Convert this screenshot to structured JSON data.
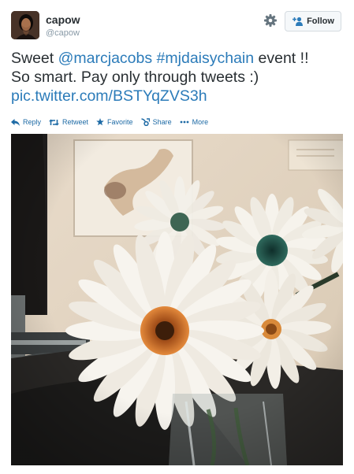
{
  "user": {
    "display_name": "capow",
    "screen_name": "@capow"
  },
  "follow_button": {
    "label": "Follow"
  },
  "tweet": {
    "text_before": "Sweet ",
    "mention": "@marcjacobs",
    "space": " ",
    "hashtag": "#mjdaisychain",
    "text_after": " event !!",
    "line2": "So smart. Pay only through tweets :)",
    "link": "pic.twitter.com/BSTYqZVS3h"
  },
  "actions": {
    "reply": "Reply",
    "retweet": "Retweet",
    "favorite": "Favorite",
    "share": "Share",
    "more": "More"
  },
  "icons": {
    "settings": "gear-icon",
    "follow": "add-user-icon",
    "reply": "reply-icon",
    "retweet": "retweet-icon",
    "favorite": "star-icon",
    "share": "share-icon",
    "more": "ellipsis-icon"
  },
  "colors": {
    "link": "#2b7bb9",
    "action": "#1d6aa5",
    "text": "#292f33",
    "muted": "#8899a6"
  }
}
